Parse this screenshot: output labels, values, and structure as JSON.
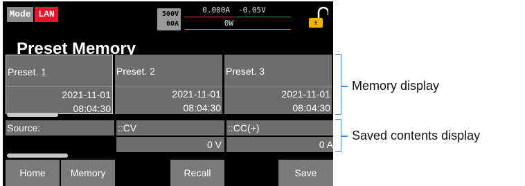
{
  "status_bar": {
    "mode_label": "Mode",
    "lan_label": "LAN",
    "voltage_rating": "500V",
    "current_rating": "60A",
    "measured_current": "0.000A",
    "measured_voltage": "-0.05V",
    "measured_power": "0W",
    "lock_icon": "unlocked-padlock-icon"
  },
  "title": "Preset Memory",
  "presets": [
    {
      "name": "Preset. 1",
      "date": "2021-11-01",
      "time": "08:04:30",
      "selected": true
    },
    {
      "name": "Preset. 2",
      "date": "2021-11-01",
      "time": "08:04:30",
      "selected": false
    },
    {
      "name": "Preset. 3",
      "date": "2021-11-01",
      "time": "08:04:30",
      "selected": false
    }
  ],
  "contents": {
    "source_label": "Source:",
    "mode1_label": "::CV",
    "mode2_label": "::CC(+)",
    "value1": "0 V",
    "value2": "0 A"
  },
  "buttons": {
    "home": "Home",
    "memory": "Memory",
    "recall": "Recall",
    "save": "Save"
  },
  "annotations": {
    "memory_display": "Memory display",
    "saved_contents_display": "Saved contents display"
  },
  "colors": {
    "lan": "#e8142b",
    "lock": "#f0b400",
    "accent_line_red": "#d0302a",
    "accent_line_green": "#2fa04a",
    "accent_line_orange": "#e07a20",
    "bracket": "#4a8fd6"
  }
}
